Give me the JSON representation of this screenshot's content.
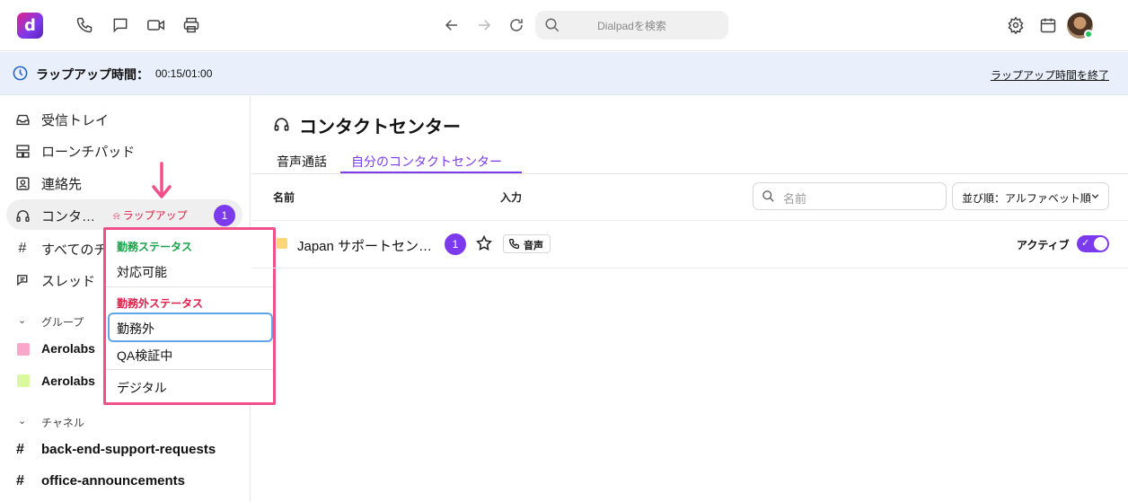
{
  "app": {
    "logo_letter": "d"
  },
  "topbar": {
    "search_placeholder": "Dialpadを検索"
  },
  "banner": {
    "title": "ラップアップ時間：",
    "time": "00:15/01:00",
    "end_link": "ラップアップ時間を終了"
  },
  "sidebar": {
    "items": [
      {
        "label": "受信トレイ"
      },
      {
        "label": "ローンチパッド"
      },
      {
        "label": "連絡先"
      },
      {
        "label": "コンタ…",
        "tag": "ラップアップ",
        "badge": "1"
      },
      {
        "label": "すべてのチ"
      },
      {
        "label": "スレッド"
      }
    ],
    "groups_label": "グループ",
    "groups": [
      {
        "label": "Aerolabs",
        "color": "#f9a8c9"
      },
      {
        "label": "Aerolabs",
        "color": "#d9f99d"
      }
    ],
    "channels_label": "チャネル",
    "channels": [
      {
        "label": "back-end-support-requests"
      },
      {
        "label": "office-announcements"
      }
    ]
  },
  "dropdown": {
    "on_duty_header": "勤務ステータス",
    "on_duty_items": [
      "対応可能"
    ],
    "off_duty_header": "勤務外ステータス",
    "off_duty_items": [
      "勤務外",
      "QA検証中"
    ],
    "other_items": [
      "デジタル"
    ]
  },
  "main": {
    "title": "コンタクトセンター",
    "tabs": [
      "音声通話",
      "自分のコンタクトセンター"
    ],
    "active_tab": "自分のコンタクトセンター",
    "columns": {
      "name": "名前",
      "input": "入力"
    },
    "filter_placeholder": "名前",
    "sort_label": "並び順：アルファベット順",
    "rows": [
      {
        "name": "Japan サポートセン…",
        "badge": "1",
        "channel": "音声",
        "status": "アクティブ",
        "active": true
      }
    ]
  },
  "colors": {
    "accent": "#7c3aed",
    "highlight_border": "#f0508a",
    "on_duty": "#16a34a",
    "off_duty": "#e11d48"
  }
}
